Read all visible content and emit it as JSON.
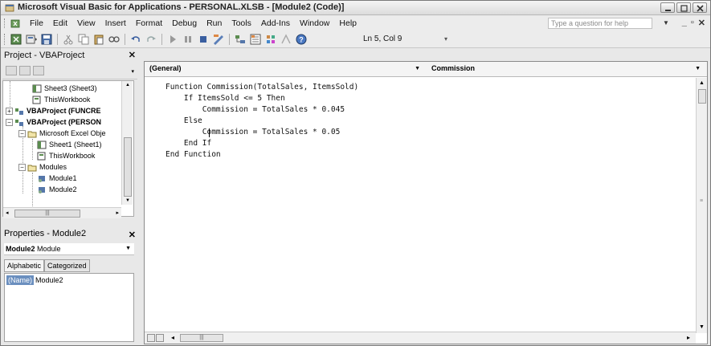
{
  "window": {
    "title": "Microsoft Visual Basic for Applications - PERSONAL.XLSB - [Module2 (Code)]"
  },
  "menubar": {
    "items": [
      {
        "label": "File"
      },
      {
        "label": "Edit"
      },
      {
        "label": "View"
      },
      {
        "label": "Insert"
      },
      {
        "label": "Format"
      },
      {
        "label": "Debug"
      },
      {
        "label": "Run"
      },
      {
        "label": "Tools"
      },
      {
        "label": "Add-Ins"
      },
      {
        "label": "Window"
      },
      {
        "label": "Help"
      }
    ],
    "help_placeholder": "Type a question for help"
  },
  "toolbar": {
    "cursor_position": "Ln 5, Col 9"
  },
  "project_pane": {
    "title": "Project - VBAProject",
    "tree": [
      {
        "label": "Sheet3 (Sheet3)",
        "bold": false
      },
      {
        "label": "ThisWorkbook",
        "bold": false
      },
      {
        "label": "VBAProject (FUNCRE",
        "bold": true
      },
      {
        "label": "VBAProject (PERSON",
        "bold": true
      },
      {
        "label": "Microsoft Excel Obje",
        "bold": false
      },
      {
        "label": "Sheet1 (Sheet1)",
        "bold": false
      },
      {
        "label": "ThisWorkbook",
        "bold": false
      },
      {
        "label": "Modules",
        "bold": false
      },
      {
        "label": "Module1",
        "bold": false
      },
      {
        "label": "Module2",
        "bold": false
      }
    ]
  },
  "properties_pane": {
    "title": "Properties - Module2",
    "object_name": "Module2",
    "object_type": "Module",
    "tabs": [
      {
        "label": "Alphabetic"
      },
      {
        "label": "Categorized"
      }
    ],
    "rows": [
      {
        "name": "(Name)",
        "value": "Module2"
      }
    ]
  },
  "code_window": {
    "object_combo": "(General)",
    "procedure_combo": "Commission",
    "lines": [
      "Function Commission(TotalSales, ItemsSold)",
      "    If ItemsSold <= 5 Then",
      "        Commission = TotalSales * 0.045",
      "    Else",
      "        Commission = TotalSales * 0.05",
      "    End If",
      "End Function"
    ]
  },
  "icons": {
    "title_icon": "vba-app-icon",
    "close": "close-icon"
  }
}
